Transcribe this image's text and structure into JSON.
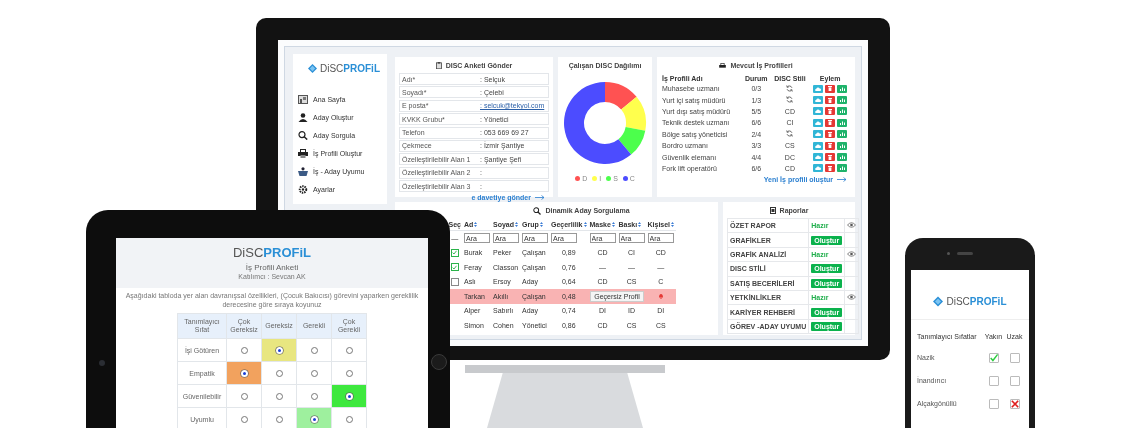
{
  "monitor": {
    "sidebar": {
      "brand": {
        "left": "DiSC",
        "right": "PROFiL"
      },
      "items": [
        {
          "kind": "home",
          "label": "Ana Sayfa"
        },
        {
          "kind": "person",
          "label": "Aday Oluştur"
        },
        {
          "kind": "search",
          "label": "Aday Sorgula"
        },
        {
          "kind": "printer",
          "label": "İş Profili Oluştur"
        },
        {
          "kind": "basket",
          "label": "İş - Aday Uyumu"
        },
        {
          "kind": "settings",
          "label": "Ayarlar"
        }
      ]
    },
    "survey_form": {
      "title": "DISC Anketi Gönder",
      "fields": [
        {
          "kind": "text",
          "label": "Adı*",
          "value": ": Selçuk"
        },
        {
          "kind": "text",
          "label": "Soyadı*",
          "value": ": Çelebi"
        },
        {
          "kind": "email",
          "label": "E posta*",
          "value": ": selcuk@tekyol.com"
        },
        {
          "kind": "text",
          "label": "KVKK Grubu*",
          "value": ": Yönetici"
        },
        {
          "kind": "text",
          "label": "Telefon",
          "value": ": 053 669 69 27"
        },
        {
          "kind": "text",
          "label": "Çekmece",
          "value": ": İzmir Şantiye"
        },
        {
          "kind": "text",
          "label": "Özelleştirilebilir Alan 1",
          "value": ": Şantiye Şefi"
        },
        {
          "kind": "text",
          "label": "Özelleştirilebilir Alan 2",
          "value": ":"
        },
        {
          "kind": "text",
          "label": "Özelleştirilebilir Alan 3",
          "value": ":"
        }
      ],
      "link": "e davetiye gönder"
    },
    "chart": {
      "title": "Çalışan DISC Dağılımı",
      "legend": [
        {
          "label": "D",
          "color": "#ff5252"
        },
        {
          "label": "I",
          "color": "#ffff4d"
        },
        {
          "label": "S",
          "color": "#4cff4c"
        },
        {
          "label": "C",
          "color": "#4c4cff"
        }
      ]
    },
    "job_profiles": {
      "title": "Mevcut İş Profilleri",
      "columns": [
        "İş Profili Adı",
        "Durum",
        "DISC Stili",
        "Eylem"
      ],
      "rows": [
        {
          "kind": "pending",
          "name": "Muhasebe uzmanı",
          "status": "0/3"
        },
        {
          "kind": "pending",
          "name": "Yurt içi satış müdürü",
          "status": "1/3"
        },
        {
          "kind": "done",
          "name": "Yurt dışı satış müdürü",
          "status": "5/5",
          "style": "CD"
        },
        {
          "kind": "done",
          "name": "Teknik destek uzmanı",
          "status": "6/6",
          "style": "CI"
        },
        {
          "kind": "pending",
          "name": "Bölge satış yöneticisi",
          "status": "2/4"
        },
        {
          "kind": "done",
          "name": "Bordro uzmanı",
          "status": "3/3",
          "style": "CS"
        },
        {
          "kind": "done",
          "name": "Güvenlik elemanı",
          "status": "4/4",
          "style": "DC"
        },
        {
          "kind": "done",
          "name": "Fork lift operatörü",
          "status": "6/6",
          "style": "CD"
        }
      ],
      "link": "Yeni İş profili oluştur"
    },
    "query": {
      "title": "Dinamik Aday Sorgulama",
      "select_column": "Seç",
      "columns": [
        "Ad",
        "Soyad",
        "Grup",
        "Geçerlilik",
        "Maske",
        "Baskı",
        "Kişisel"
      ],
      "select_filter": "—",
      "filters": [
        {
          "placeholder": "Ara"
        },
        {
          "placeholder": "Ara"
        },
        {
          "placeholder": "Ara"
        },
        {
          "placeholder": "Ara"
        },
        {
          "placeholder": "Ara"
        },
        {
          "placeholder": "Ara"
        },
        {
          "placeholder": "Ara"
        }
      ],
      "rows": [
        {
          "checked": true,
          "flagged": false,
          "cells": [
            "Burak",
            "Peker",
            "Çalışan",
            "0,89",
            "CD",
            "CI",
            "CD"
          ]
        },
        {
          "checked": true,
          "flagged": false,
          "cells": [
            "Feray",
            "Classon",
            "Çalışan",
            "0,76",
            "—",
            "—",
            "—"
          ]
        },
        {
          "checked": false,
          "flagged": false,
          "cells": [
            "Aslı",
            "Ersoy",
            "Aday",
            "0,64",
            "CD",
            "CS",
            "C"
          ]
        },
        {
          "flagged": true,
          "cells": [
            "Tarkan",
            "Akıllı",
            "Çalışan",
            "0,48"
          ],
          "note": "Geçersiz Profil"
        },
        {
          "flagged": false,
          "cells": [
            "Alper",
            "Sabırlı",
            "Aday",
            "0,74",
            "DI",
            "ID",
            "DI"
          ]
        },
        {
          "flagged": false,
          "cells": [
            "Simon",
            "Cohen",
            "Yönetici",
            "0,86",
            "CD",
            "CS",
            "CS"
          ]
        }
      ]
    },
    "reports": {
      "title": "Raporlar",
      "rows": [
        {
          "kind": "ready",
          "name": "ÖZET RAPOR",
          "status": "Hazır"
        },
        {
          "kind": "create",
          "name": "GRAFİKLER",
          "button": "Oluştur"
        },
        {
          "kind": "ready",
          "name": "GRAFİK ANALİZİ",
          "status": "Hazır"
        },
        {
          "kind": "create",
          "name": "DISC STİLİ",
          "button": "Oluştur"
        },
        {
          "kind": "create",
          "name": "SATIŞ BECERİLERİ",
          "button": "Oluştur"
        },
        {
          "kind": "ready",
          "name": "YETKİNLİKLER",
          "status": "Hazır"
        },
        {
          "kind": "create",
          "name": "KARİYER REHBERİ",
          "button": "Oluştur"
        },
        {
          "kind": "create",
          "name": "GÖREV -ADAY UYUMU",
          "button": "Oluştur"
        }
      ]
    }
  },
  "tablet": {
    "brand": {
      "left": "DiSC",
      "right": "PROFiL"
    },
    "title": "İş Profili Anketi",
    "participant": "Katılımcı : Sevcan AK",
    "instruction": "Aşağıdaki tabloda yer alan davranışsal özellikleri, (Çocuk Bakıcısı) görevini yaparken gereklilik derecesine göre sıraya koyunuz",
    "columns": [
      "Tanımlayıcı Sıfat",
      "Çok Gereksiz",
      "Gereksiz",
      "Gerekli",
      "Çok Gerekli"
    ],
    "rows": [
      {
        "label": "İşi Götüren",
        "color": "#e8e680",
        "options": [
          {
            "selected": false
          },
          {
            "selected": true
          },
          {
            "selected": false
          },
          {
            "selected": false
          }
        ]
      },
      {
        "label": "Empatik",
        "color": "#f2a25e",
        "options": [
          {
            "selected": true
          },
          {
            "selected": false
          },
          {
            "selected": false
          },
          {
            "selected": false
          }
        ]
      },
      {
        "label": "Güvenilebilir",
        "color": "#3ee83e",
        "options": [
          {
            "selected": false
          },
          {
            "selected": false
          },
          {
            "selected": false
          },
          {
            "selected": true
          }
        ]
      },
      {
        "label": "Uyumlu",
        "color": "#9ef09e",
        "options": [
          {
            "selected": false
          },
          {
            "selected": false
          },
          {
            "selected": true
          },
          {
            "selected": false
          }
        ]
      }
    ]
  },
  "phone": {
    "brand": {
      "left": "DiSC",
      "right": "PROFiL"
    },
    "columns": [
      "Tanımlayıcı Sıfatlar",
      "Yakın",
      "Uzak"
    ],
    "rows": [
      {
        "label": "Nazik",
        "near": true,
        "far": false
      },
      {
        "label": "İnandırıcı",
        "near": false,
        "far": false
      },
      {
        "label": "Alçakgönüllü",
        "near": false,
        "far": true
      }
    ]
  }
}
